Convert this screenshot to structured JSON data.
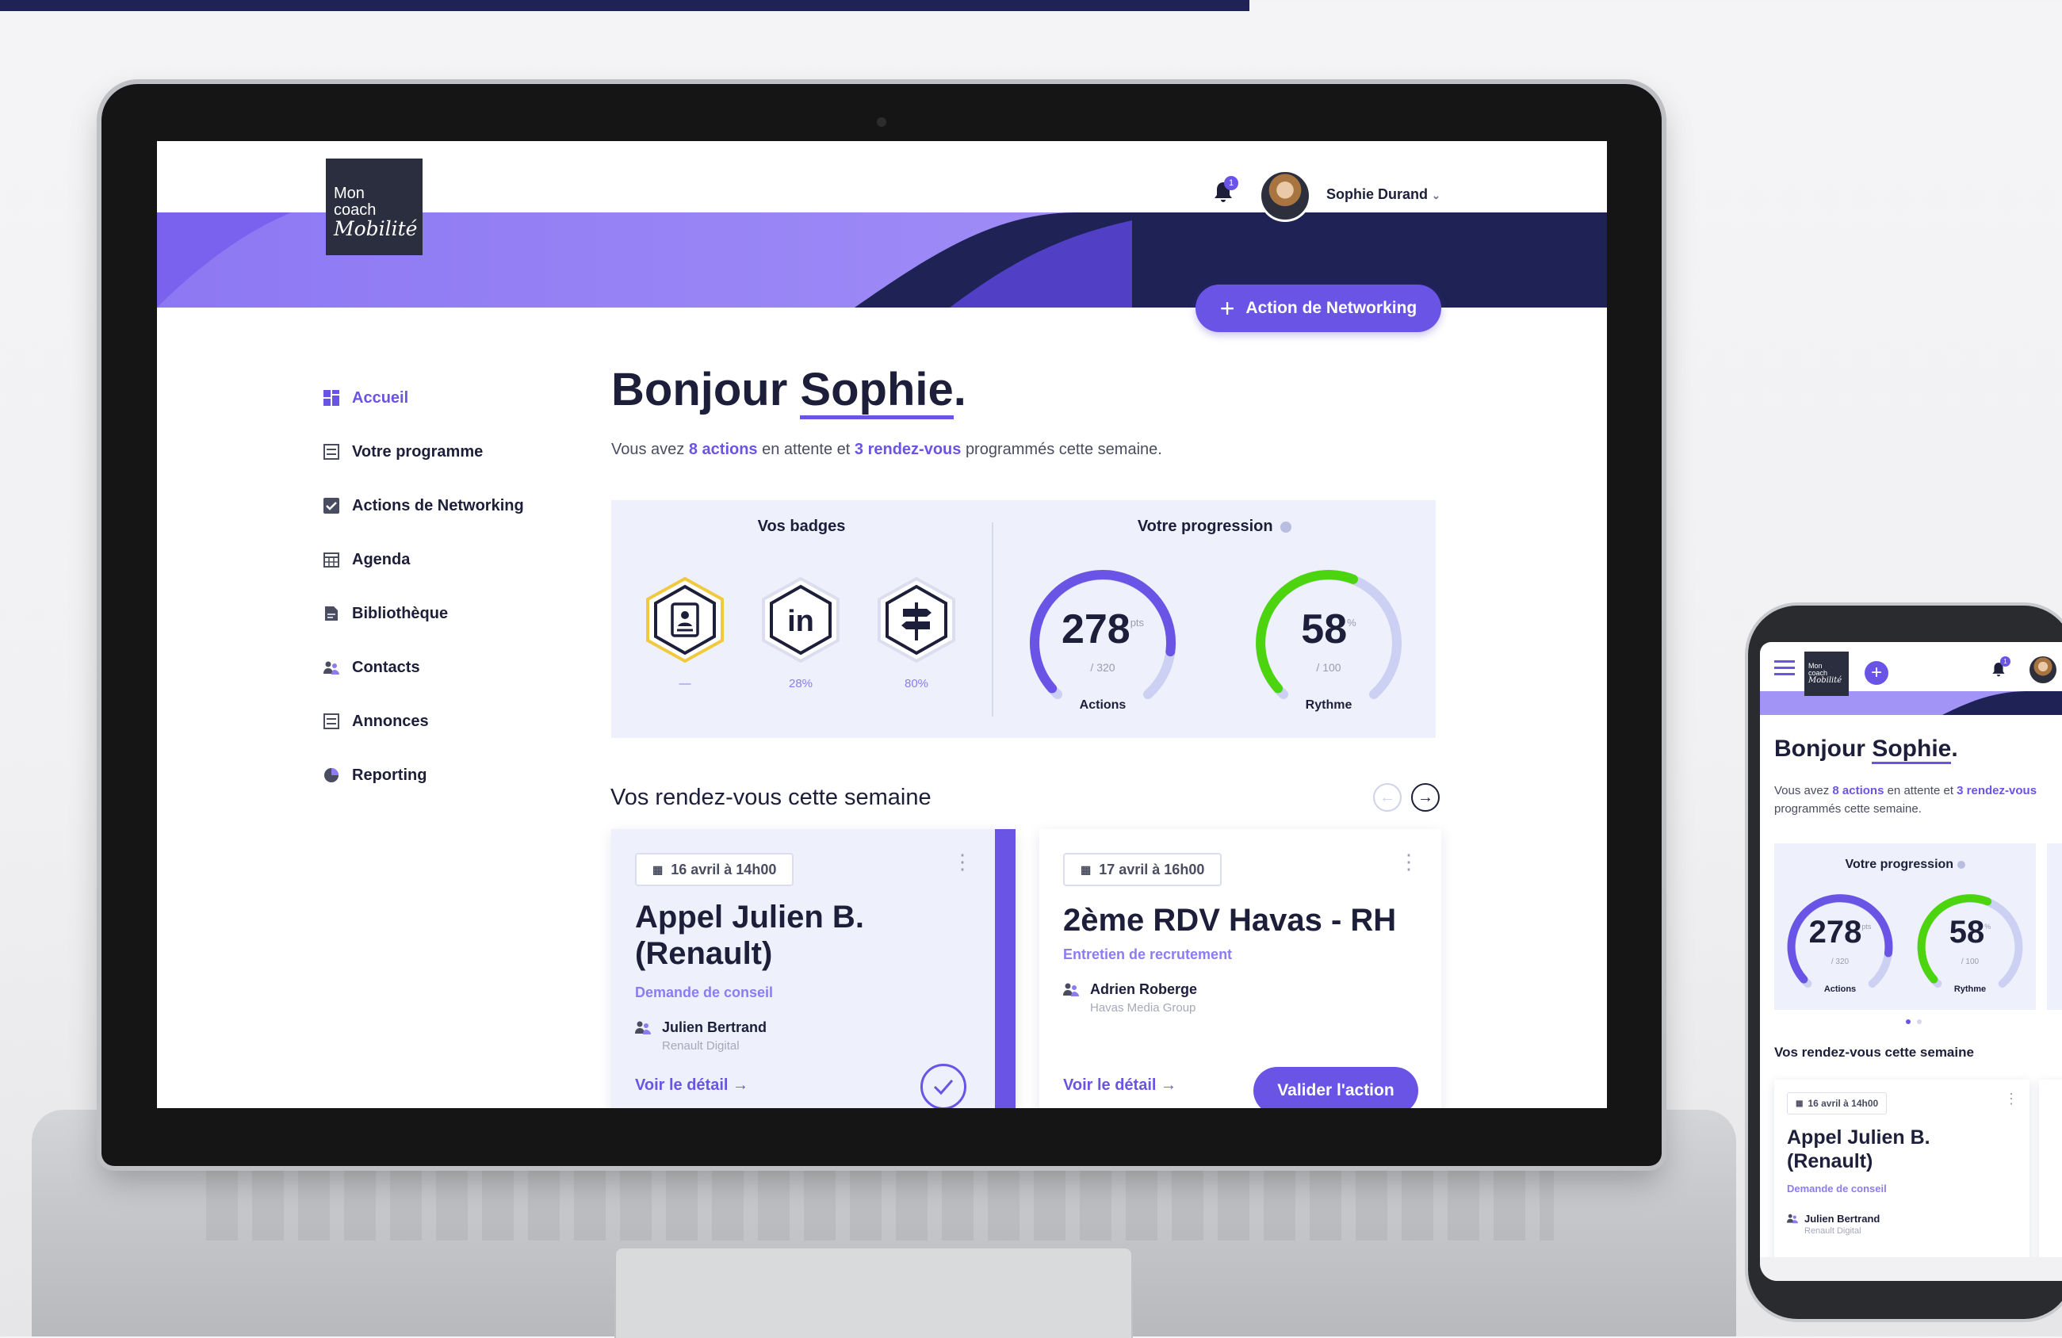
{
  "app": {
    "logo_line1": "Mon",
    "logo_line2": "coach",
    "logo_script": "Mobilité"
  },
  "header": {
    "notification_count": "1",
    "user_name": "Sophie Durand",
    "user_caret": "⌄",
    "cta_icon": "+",
    "cta_label": "Action de Networking"
  },
  "sidebar": {
    "items": [
      {
        "label": "Accueil",
        "icon": "dashboard-icon",
        "active": true
      },
      {
        "label": "Votre programme",
        "icon": "list-icon"
      },
      {
        "label": "Actions de Networking",
        "icon": "checkbox-icon"
      },
      {
        "label": "Agenda",
        "icon": "calendar-icon"
      },
      {
        "label": "Bibliothèque",
        "icon": "document-icon"
      },
      {
        "label": "Contacts",
        "icon": "contacts-icon"
      },
      {
        "label": "Annonces",
        "icon": "list-icon"
      },
      {
        "label": "Reporting",
        "icon": "pie-chart-icon"
      }
    ]
  },
  "main": {
    "greeting_prefix": "Bonjour",
    "greeting_name": "Sophie",
    "greeting_suffix": ".",
    "summary": {
      "prefix": "Vous avez",
      "actions": "8 actions",
      "middle": "en attente et",
      "rdv": "3 rendez-vous",
      "suffix": "programmés cette semaine."
    },
    "badges": {
      "title": "Vos badges",
      "items": [
        {
          "icon": "profile-card-icon",
          "value": "—",
          "earned": true
        },
        {
          "icon": "linkedin-icon",
          "value": "28%",
          "earned": false
        },
        {
          "icon": "signpost-icon",
          "value": "80%",
          "earned": false
        }
      ]
    },
    "progression": {
      "title": "Votre progression",
      "gauges": [
        {
          "value": "278",
          "unit": "pts",
          "max": "/ 320",
          "label": "Actions",
          "fraction": 0.869,
          "color": "#6a54e6"
        },
        {
          "value": "58",
          "unit": "%",
          "max": "/ 100",
          "label": "Rythme",
          "fraction": 0.58,
          "color": "#4cd40f"
        }
      ]
    },
    "meetings": {
      "title": "Vos rendez-vous cette semaine",
      "cards": [
        {
          "date": "16 avril à 14h00",
          "title_line1": "Appel Julien B.",
          "title_line2": "(Renault)",
          "subtitle": "Demande de conseil",
          "person": "Julien Bertrand",
          "org": "Renault Digital",
          "link": "Voir le détail →",
          "done": true
        },
        {
          "date": "17 avril à 16h00",
          "title_line1": "2ème RDV Havas - RH",
          "subtitle": "Entretien de recrutement",
          "person": "Adrien Roberge",
          "org": "Havas Media Group",
          "link": "Voir le détail →",
          "action": "Valider l'action"
        }
      ]
    }
  },
  "mobile": {
    "notification_count": "1",
    "logo_line1": "Mon",
    "logo_line2": "coach",
    "logo_script": "Mobilité",
    "plus": "+",
    "greeting_prefix": "Bonjour",
    "greeting_name": "Sophie",
    "greeting_suffix": ".",
    "summary_prefix": "Vous avez",
    "summary_actions": "8 actions",
    "summary_middle": "en attente et",
    "summary_rdv": "3 rendez-vous",
    "summary_suffix": "programmés cette semaine.",
    "progression_title": "Votre progression",
    "gauges": [
      {
        "value": "278",
        "unit": "pts",
        "max": "/ 320",
        "label": "Actions"
      },
      {
        "value": "58",
        "unit": "%",
        "max": "/ 100",
        "label": "Rythme"
      }
    ],
    "section_title": "Vos rendez-vous cette semaine",
    "card": {
      "date": "16 avril à 14h00",
      "title_line1": "Appel Julien B.",
      "title_line2": "(Renault)",
      "subtitle": "Demande de conseil",
      "person": "Julien Bertrand",
      "org": "Renault Digital"
    }
  },
  "colors": {
    "accent": "#6a54e6",
    "navy": "#1f2255",
    "green": "#4cd40f"
  }
}
